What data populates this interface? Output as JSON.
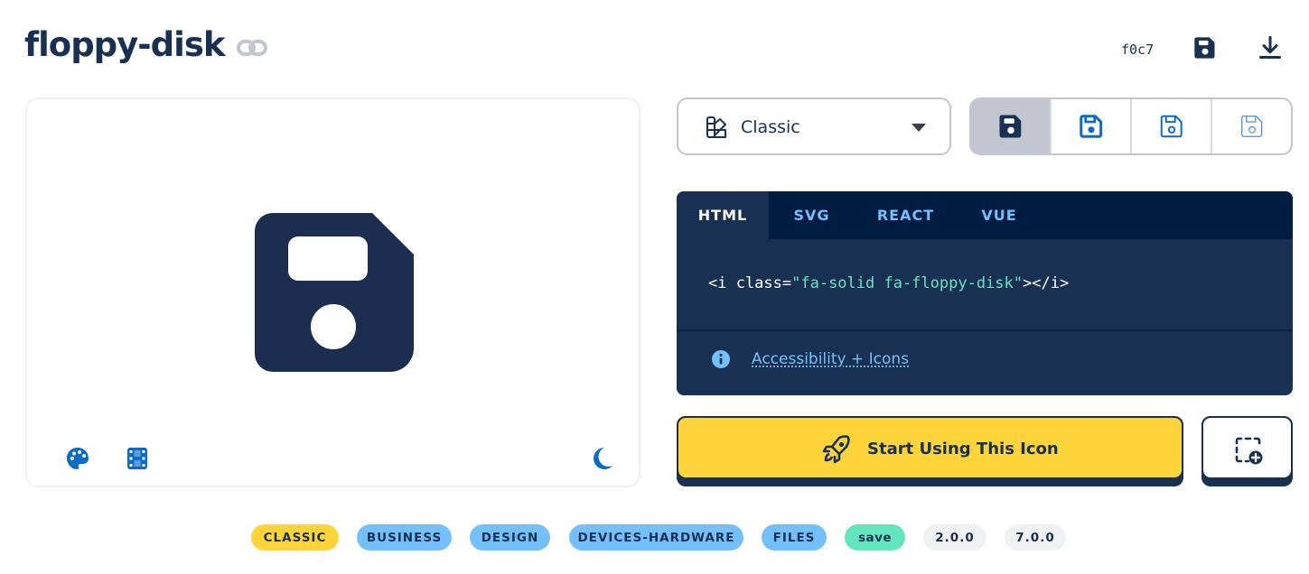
{
  "icon": {
    "name": "floppy-disk",
    "unicode": "f0c7"
  },
  "header": {
    "copy_link_icon": "link-icon",
    "save_icon": "floppy-disk-icon",
    "download_icon": "download-icon"
  },
  "preview": {
    "icon": "floppy-disk-icon",
    "tools": [
      "palette-icon",
      "film-icon",
      "moon-icon"
    ]
  },
  "style_select": {
    "icon": "swatchbook-icon",
    "value": "Classic"
  },
  "variants": [
    "solid",
    "regular",
    "light",
    "thin"
  ],
  "code": {
    "tabs": [
      "HTML",
      "SVG",
      "REACT",
      "VUE"
    ],
    "active_tab": "HTML",
    "snippet_prefix": "<i class=",
    "snippet_class": "\"fa-solid fa-floppy-disk\"",
    "snippet_suffix": "></i>",
    "accessibility_link": "Accessibility + Icons"
  },
  "actions": {
    "start_label": "Start Using This Icon",
    "start_icon": "rocket-icon",
    "add_icon": "add-to-kit-icon"
  },
  "tags": [
    {
      "label": "CLASSIC",
      "color": "#ffd43b"
    },
    {
      "label": "BUSINESS",
      "color": "#74c0fc"
    },
    {
      "label": "DESIGN",
      "color": "#74c0fc"
    },
    {
      "label": "DEVICES-HARDWARE",
      "color": "#74c0fc"
    },
    {
      "label": "FILES",
      "color": "#74c0fc"
    },
    {
      "label": "save",
      "color": "#63e6be"
    },
    {
      "label": "2.0.0",
      "color": "#f0f1f3"
    },
    {
      "label": "7.0.0",
      "color": "#f0f1f3"
    }
  ],
  "colors": {
    "navy": "#183153",
    "dark_navy": "#001c40",
    "yellow": "#ffd43b",
    "blue": "#0c6bc4",
    "light_blue": "#74c0fc",
    "mint": "#63e6be"
  }
}
